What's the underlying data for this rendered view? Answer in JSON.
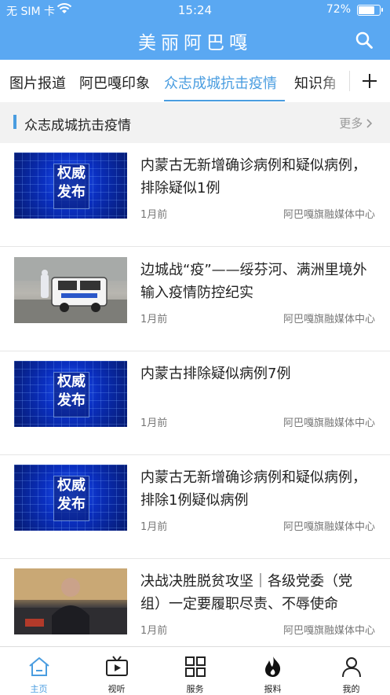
{
  "status": {
    "carrier": "无 SIM 卡",
    "time": "15:24",
    "battery": "72%"
  },
  "header": {
    "title": "美丽阿巴嘎"
  },
  "tabs": [
    "图片报道",
    "阿巴嘎印象",
    "众志成城抗击疫情",
    "知识角"
  ],
  "section": {
    "title": "众志成城抗击疫情",
    "more": "更多"
  },
  "thumb_text": {
    "line1": "权威",
    "line2": "发布"
  },
  "articles": [
    {
      "title": "内蒙古无新增确诊病例和疑似病例，排除疑似1例",
      "time": "1月前",
      "source": "阿巴嘎旗融媒体中心"
    },
    {
      "title": "边城战“疫”——绥芬河、满洲里境外输入疫情防控纪实",
      "time": "1月前",
      "source": "阿巴嘎旗融媒体中心"
    },
    {
      "title": "内蒙古排除疑似病例7例",
      "time": "1月前",
      "source": "阿巴嘎旗融媒体中心"
    },
    {
      "title": "内蒙古无新增确诊病例和疑似病例，排除1例疑似病例",
      "time": "1月前",
      "source": "阿巴嘎旗融媒体中心"
    },
    {
      "title": "决战决胜脱贫攻坚｜各级党委（党组）一定要履职尽责、不辱使命",
      "time": "1月前",
      "source": "阿巴嘎旗融媒体中心"
    }
  ],
  "tabbar": [
    {
      "label": "主页",
      "icon": "home-icon",
      "active": true
    },
    {
      "label": "视听",
      "icon": "tv-icon"
    },
    {
      "label": "服务",
      "icon": "grid-icon"
    },
    {
      "label": "报料",
      "icon": "fire-icon"
    },
    {
      "label": "我的",
      "icon": "person-icon"
    }
  ],
  "colors": {
    "brand": "#5aa8f2",
    "accent": "#4a9de0"
  }
}
